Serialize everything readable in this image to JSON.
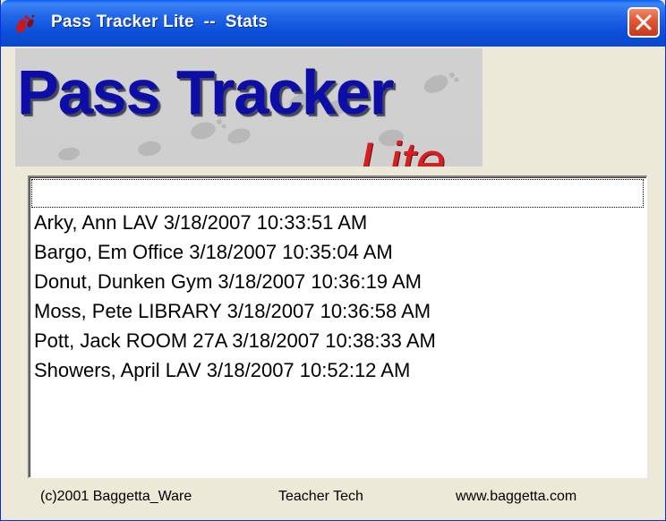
{
  "window": {
    "title": "Pass Tracker Lite  --  Stats",
    "icon": "footprints-icon",
    "close_icon": "close-icon"
  },
  "banner": {
    "title": "Pass Tracker",
    "subtitle": "Lite"
  },
  "list": {
    "items": [
      "",
      "Arky, Ann LAV 3/18/2007 10:33:51 AM",
      "Bargo, Em Office 3/18/2007 10:35:04 AM",
      "Donut, Dunken Gym 3/18/2007 10:36:19 AM",
      "Moss, Pete LIBRARY 3/18/2007 10:36:58 AM",
      "Pott, Jack ROOM 27A 3/18/2007 10:38:33 AM",
      "Showers, April LAV 3/18/2007 10:52:12 AM"
    ]
  },
  "status": {
    "copyright": "(c)2001 Baggetta_Ware",
    "center": "Teacher Tech",
    "website": "www.baggetta.com"
  },
  "colors": {
    "titlebar": "#0b4fd9",
    "close_button": "#e25a36",
    "banner_title": "#0d0ea8",
    "banner_subtitle": "#d42020",
    "window_bg": "#ece9d8"
  }
}
